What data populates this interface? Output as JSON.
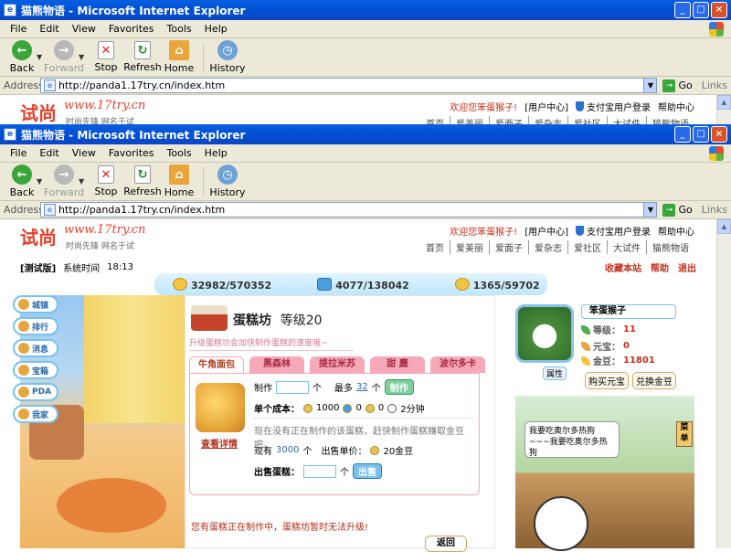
{
  "windows": [
    {
      "title": "猫熊物语 - Microsoft Internet Explorer",
      "menu": [
        "File",
        "Edit",
        "View",
        "Favorites",
        "Tools",
        "Help"
      ],
      "toolbar": {
        "back": "Back",
        "forward": "Forward",
        "stop": "Stop",
        "refresh": "Refresh",
        "home": "Home",
        "history": "History"
      },
      "address_label": "Address",
      "url": "http://panda1.17try.cn/index.htm",
      "go": "Go",
      "links": "Links"
    },
    {
      "title": "猫熊物语 - Microsoft Internet Explorer",
      "menu": [
        "File",
        "Edit",
        "View",
        "Favorites",
        "Tools",
        "Help"
      ],
      "toolbar": {
        "back": "Back",
        "forward": "Forward",
        "stop": "Stop",
        "refresh": "Refresh",
        "home": "Home",
        "history": "History"
      },
      "address_label": "Address",
      "url": "http://panda1.17try.cn/index.htm",
      "go": "Go",
      "links": "Links"
    }
  ],
  "site": {
    "logo": "试尚",
    "logo_url": "www.17try.cn",
    "slogan": "时尚先锋 网名于试",
    "welcome": "欢迎您笨蛋猴子!",
    "user_center": "[用户中心]",
    "pay_login": "支付宝用户登录",
    "help_center": "帮助中心",
    "nav": [
      "首页",
      "爱美丽",
      "爱面子",
      "爱杂志",
      "爱社区",
      "大试件",
      "猫熊物语"
    ]
  },
  "game": {
    "version": "[测试版]",
    "system_time_label": "系统时间",
    "system_time": "18:13",
    "top_links": [
      "收藏本站",
      "帮助",
      "退出"
    ],
    "resources": [
      "32982/570352",
      "4077/138042",
      "1365/59702"
    ],
    "side_buttons": [
      "城镇",
      "排行",
      "消息",
      "宝箱",
      "PDA",
      "我家"
    ],
    "shop": {
      "name": "蛋糕坊",
      "level": "等级20",
      "subtitle": "升级蛋糕坊会加快制作蛋糕的速度哦~",
      "tabs": [
        "牛角面包",
        "黑森林",
        "提拉米苏",
        "甜 麋",
        "波尔多卡"
      ],
      "make_label": "制作",
      "unit": "个",
      "max_label": "最多",
      "max_value": "32",
      "make_btn": "制作",
      "cost_label": "单个成本：",
      "cost_coin": "1000",
      "cost_a": "0",
      "cost_b": "0",
      "cost_time": "2分钟",
      "status_text": "现在没有正在制作的该蛋糕，赶快制作蛋糕赚取金豆吧。",
      "stock_label": "现有",
      "stock_value": "3000",
      "price_label": "出售单价：",
      "price_value": "20金豆",
      "sell_label": "出售蛋糕：",
      "sell_btn": "出售",
      "detail_link": "查看详情",
      "notice": "您有蛋糕正在制作中，蛋糕坊暂时无法升级!",
      "back_btn": "返回"
    },
    "player": {
      "name": "笨蛋猴子",
      "level_label": "等级：",
      "level": "11",
      "yuanbao_label": "元宝：",
      "yuanbao": "0",
      "gold_label": "金豆：",
      "gold": "11801",
      "attr_btn": "属性",
      "buy_btn": "购买元宝",
      "exchange_btn": "兑换金豆",
      "bubble": "我要吃奥尔多热狗~~~我要吃奥尔多热狗",
      "sign": "菜单"
    }
  }
}
